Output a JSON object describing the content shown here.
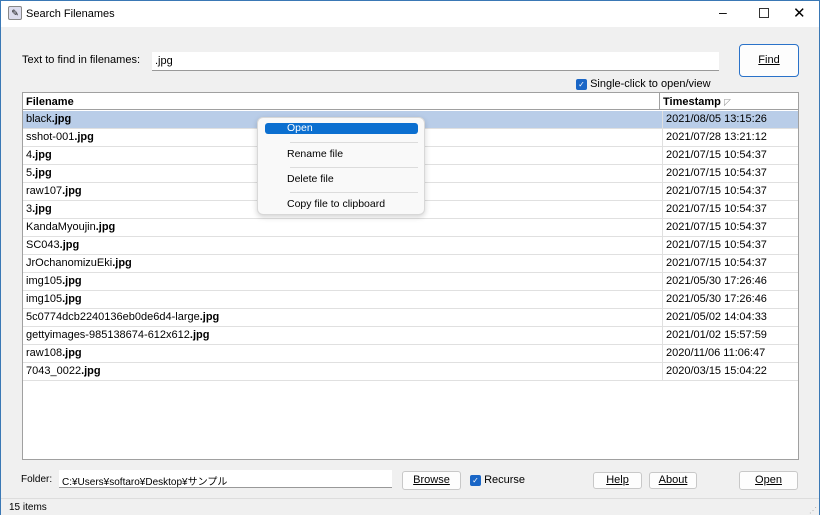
{
  "window": {
    "title": "Search Filenames",
    "icon": "app-search-icon"
  },
  "search": {
    "label": "Text to find in filenames:",
    "value": ".jpg",
    "find_label": "Find",
    "single_click_label": "Single-click to open/view",
    "single_click_checked": true
  },
  "table": {
    "columns": [
      "Filename",
      "Timestamp"
    ],
    "sort_indicator": "sort-descending-icon",
    "rows": [
      {
        "name": "black",
        "ext": ".jpg",
        "timestamp": "2021/08/05 13:15:26",
        "selected": true
      },
      {
        "name": "sshot-001",
        "ext": ".jpg",
        "timestamp": "2021/07/28 13:21:12"
      },
      {
        "name": "4",
        "ext": ".jpg",
        "timestamp": "2021/07/15 10:54:37"
      },
      {
        "name": "5",
        "ext": ".jpg",
        "timestamp": "2021/07/15 10:54:37"
      },
      {
        "name": "raw107",
        "ext": ".jpg",
        "timestamp": "2021/07/15 10:54:37"
      },
      {
        "name": "3",
        "ext": ".jpg",
        "timestamp": "2021/07/15 10:54:37"
      },
      {
        "name": "KandaMyoujin",
        "ext": ".jpg",
        "timestamp": "2021/07/15 10:54:37"
      },
      {
        "name": "SC043",
        "ext": ".jpg",
        "timestamp": "2021/07/15 10:54:37"
      },
      {
        "name": "JrOchanomizuEki",
        "ext": ".jpg",
        "timestamp": "2021/07/15 10:54:37"
      },
      {
        "name": "img105",
        "ext": ".jpg",
        "timestamp": "2021/05/30 17:26:46"
      },
      {
        "name": "img105",
        "ext": ".jpg",
        "timestamp": "2021/05/30 17:26:46"
      },
      {
        "name": "5c0774dcb2240136eb0de6d4-large",
        "ext": ".jpg",
        "timestamp": "2021/05/02 14:04:33"
      },
      {
        "name": "gettyimages-985138674-612x612",
        "ext": ".jpg",
        "timestamp": "2021/01/02 15:57:59"
      },
      {
        "name": "raw108",
        "ext": ".jpg",
        "timestamp": "2020/11/06 11:06:47"
      },
      {
        "name": "7043_0022",
        "ext": ".jpg",
        "timestamp": "2020/03/15 15:04:22"
      }
    ]
  },
  "context_menu": {
    "items": [
      "Open",
      "Rename file",
      "Delete file",
      "Copy file to clipboard"
    ],
    "highlighted": "Open"
  },
  "footer": {
    "folder_label": "Folder:",
    "folder_value": "C:¥Users¥softaro¥Desktop¥サンプル",
    "browse_label": "Browse",
    "recurse_label": "Recurse",
    "recurse_checked": true,
    "help_label": "Help",
    "about_label": "About",
    "open_label": "Open"
  },
  "status": {
    "text": "15 items"
  },
  "colors": {
    "accent": "#0b6fd0",
    "selection": "#b9cde8"
  }
}
